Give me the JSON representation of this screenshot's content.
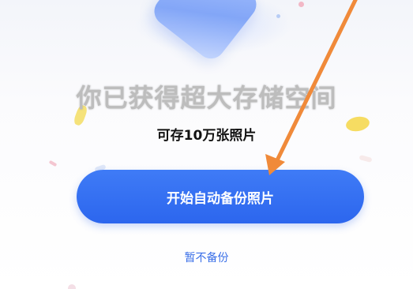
{
  "dialog": {
    "headline": "你已获得超大存储空间",
    "subtitle": "可存10万张照片",
    "primary_button": "开始自动备份照片",
    "secondary_link": "暂不备份"
  },
  "colors": {
    "primary": "#2c66ee",
    "link": "#3a6fe8",
    "annotation_arrow": "#f08a3a"
  },
  "icons": {
    "illustration": "shield-icon",
    "annotation": "arrow-annotation"
  }
}
